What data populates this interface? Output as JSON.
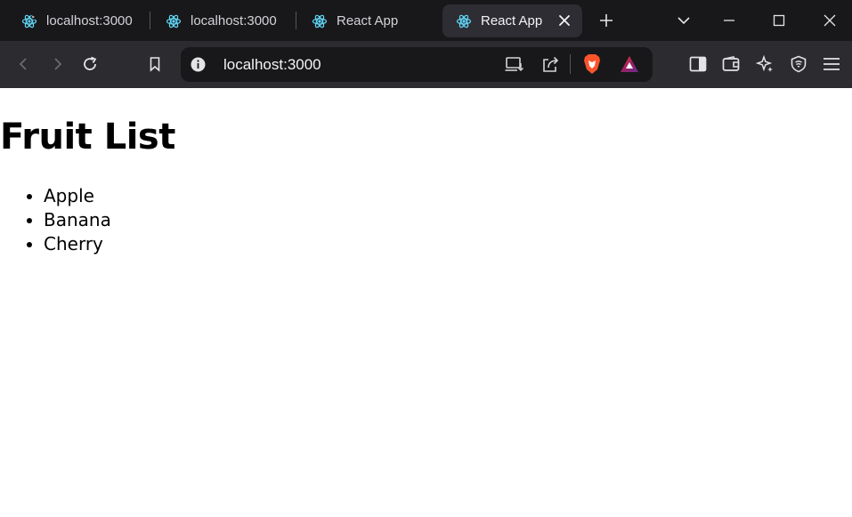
{
  "browser": {
    "tabs": [
      {
        "label": "localhost:3000",
        "icon": "react-refresh-icon",
        "active": false
      },
      {
        "label": "localhost:3000",
        "icon": "react-icon",
        "active": false
      },
      {
        "label": "React App",
        "icon": "react-icon",
        "active": false
      },
      {
        "label": "React App",
        "icon": "react-icon",
        "active": true
      }
    ],
    "address": "localhost:3000",
    "colors": {
      "tabstrip": "#18181b",
      "toolbar": "#2b2b30",
      "react": "#61dafb",
      "brave": "#fb542b"
    }
  },
  "page": {
    "title": "Fruit List",
    "items": [
      "Apple",
      "Banana",
      "Cherry"
    ]
  }
}
